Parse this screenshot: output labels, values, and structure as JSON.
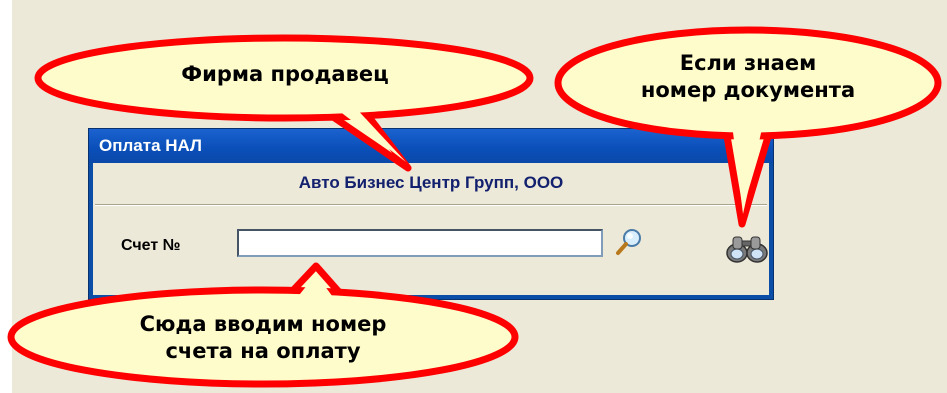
{
  "dialog": {
    "title": "Оплата НАЛ",
    "company": "Авто Бизнес Центр Групп, ООО",
    "invoice_label": "Счет №",
    "invoice_value": ""
  },
  "callouts": {
    "seller": "Фирма продавец",
    "doc_number_line1": "Если знаем",
    "doc_number_line2": "номер документа",
    "enter_line1": "Сюда вводим номер",
    "enter_line2": "счета на оплату"
  },
  "colors": {
    "titlebar": "#0a4ea8",
    "bubble_fill": "#fffccc",
    "bubble_stroke": "#ff0000",
    "company_text": "#12206e"
  },
  "icons": [
    "magnifier-icon",
    "binoculars-icon"
  ]
}
